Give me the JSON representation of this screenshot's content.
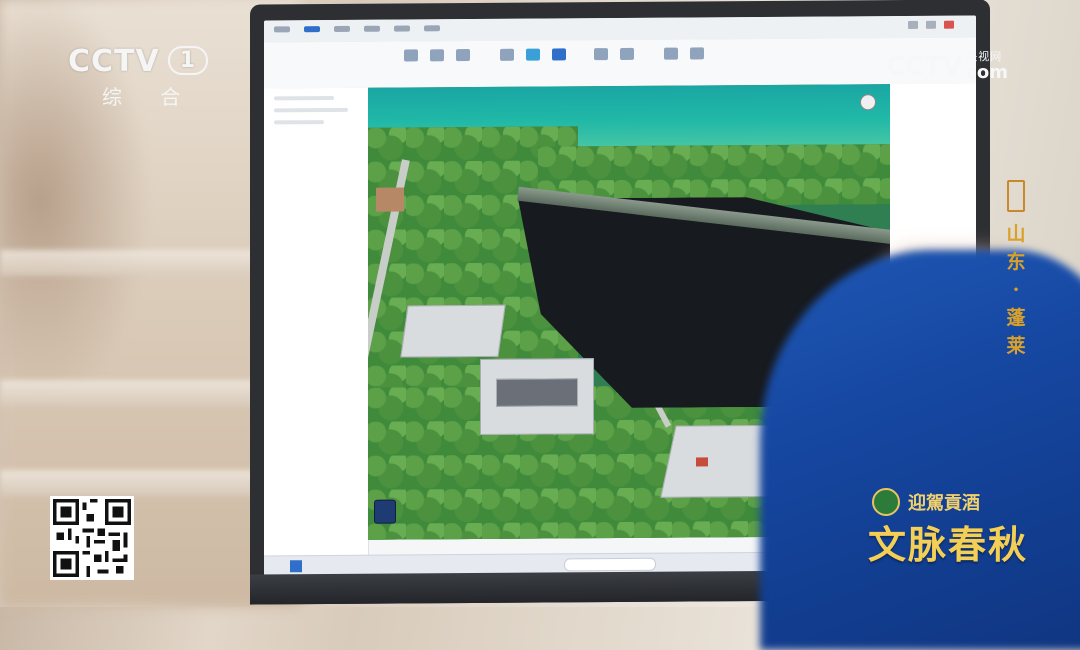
{
  "overlay": {
    "channel_logo": "CCTV",
    "channel_number": "1",
    "channel_sub": "综 合",
    "watermark_logo": "CCTV",
    "watermark_cn": "央视网",
    "watermark_com": "com",
    "location_line1": "山东",
    "location_sep": "·",
    "location_line2": "蓬莱",
    "sponsor": "迎駕貢酒",
    "program_title": "文脉春秋"
  },
  "icons": {
    "qr": "qr-code-icon",
    "compass": "compass-icon",
    "start": "windows-start-icon",
    "app": "app-taskbar-icon"
  },
  "colors": {
    "accent_gold": "#f4cf55",
    "overlay_blue": "#1546a0",
    "sea": "#1aa6a4",
    "ribbon_active": "#2f6fc9"
  }
}
